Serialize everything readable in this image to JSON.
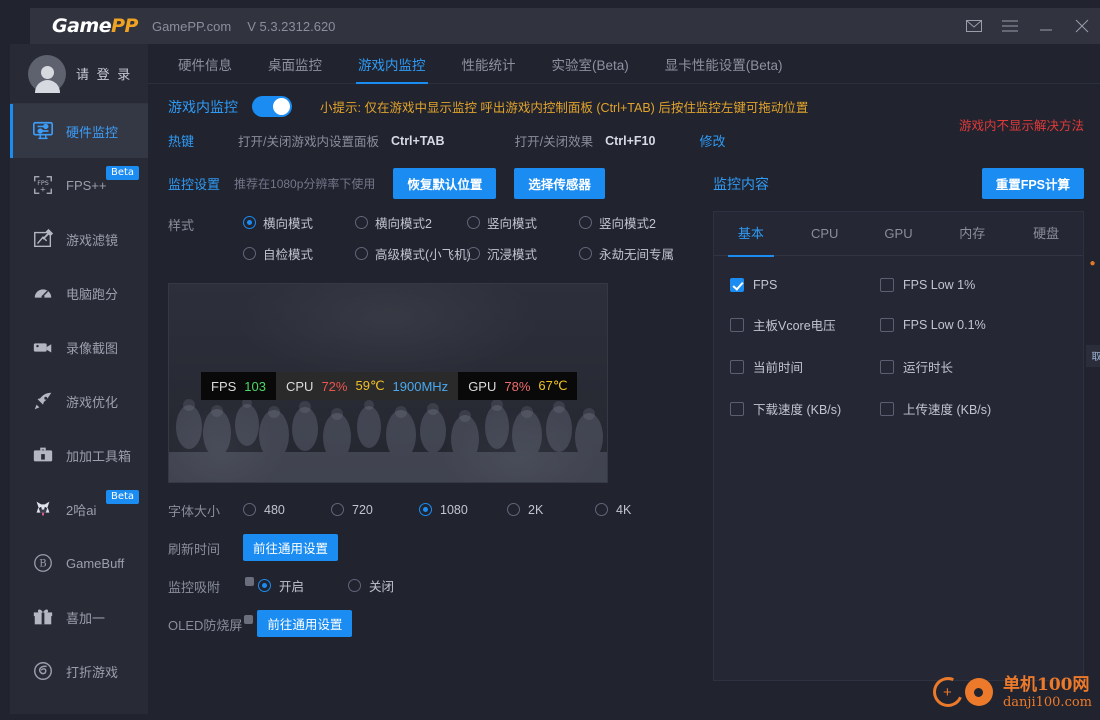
{
  "titlebar": {
    "logo_game": "Game",
    "logo_pp": "PP",
    "site": "GamePP.com",
    "version": "V 5.3.2312.620",
    "mail_icon": "mail-icon",
    "menu_icon": "menu-icon",
    "minimize_icon": "minimize-icon",
    "close_icon": "close-icon"
  },
  "sidebar": {
    "profile_label": "请 登 录",
    "items": [
      {
        "label": "硬件监控",
        "icon": "hardware-monitor-icon",
        "active": true,
        "badge": ""
      },
      {
        "label": "FPS++",
        "icon": "fps-plus-icon",
        "active": false,
        "badge": "Beta"
      },
      {
        "label": "游戏滤镜",
        "icon": "game-filter-icon",
        "active": false,
        "badge": ""
      },
      {
        "label": "电脑跑分",
        "icon": "benchmark-icon",
        "active": false,
        "badge": ""
      },
      {
        "label": "录像截图",
        "icon": "camera-icon",
        "active": false,
        "badge": ""
      },
      {
        "label": "游戏优化",
        "icon": "rocket-icon",
        "active": false,
        "badge": ""
      },
      {
        "label": "加加工具箱",
        "icon": "toolbox-icon",
        "active": false,
        "badge": ""
      },
      {
        "label": "2哈ai",
        "icon": "husky-icon",
        "active": false,
        "badge": "Beta"
      },
      {
        "label": "GameBuff",
        "icon": "gamebuff-icon",
        "active": false,
        "badge": ""
      },
      {
        "label": "喜加一",
        "icon": "gift-icon",
        "active": false,
        "badge": ""
      },
      {
        "label": "打折游戏",
        "icon": "discount-icon",
        "active": false,
        "badge": ""
      }
    ]
  },
  "tabs": [
    {
      "label": "硬件信息",
      "active": false
    },
    {
      "label": "桌面监控",
      "active": false
    },
    {
      "label": "游戏内监控",
      "active": true
    },
    {
      "label": "性能统计",
      "active": false
    },
    {
      "label": "实验室(Beta)",
      "active": false
    },
    {
      "label": "显卡性能设置(Beta)",
      "active": false
    }
  ],
  "toggle_row": {
    "label": "游戏内监控",
    "enabled": true,
    "tip": "小提示: 仅在游戏中显示监控 呼出游戏内控制面板 (Ctrl+TAB) 后按住监控左键可拖动位置"
  },
  "hotkey_row": {
    "title": "热键",
    "item1_label": "打开/关闭游戏内设置面板",
    "item1_key": "Ctrl+TAB",
    "item2_label": "打开/关闭效果",
    "item2_key": "Ctrl+F10",
    "modify_link": "修改",
    "red_link": "游戏内不显示解决方法"
  },
  "settings_header": {
    "title": "监控设置",
    "hint": "推荐在1080p分辨率下使用",
    "restore_btn": "恢复默认位置",
    "sensor_btn": "选择传感器"
  },
  "style_row": {
    "label": "样式",
    "options": [
      {
        "label": "横向模式",
        "selected": true
      },
      {
        "label": "横向模式2",
        "selected": false
      },
      {
        "label": "竖向模式",
        "selected": false
      },
      {
        "label": "竖向模式2",
        "selected": false
      },
      {
        "label": "自检模式",
        "selected": false
      },
      {
        "label": "高级模式(小飞机)",
        "selected": false
      },
      {
        "label": "沉浸模式",
        "selected": false
      },
      {
        "label": "永劫无间专属",
        "selected": false
      }
    ]
  },
  "preview_overlay": {
    "fps_label": "FPS",
    "fps_value": "103",
    "cpu_label": "CPU",
    "cpu_usage": "72%",
    "cpu_temp": "59℃",
    "cpu_clock": "1900MHz",
    "gpu_label": "GPU",
    "gpu_usage": "78%",
    "gpu_temp": "67℃"
  },
  "font_size_row": {
    "label": "字体大小",
    "options": [
      {
        "label": "480",
        "selected": false
      },
      {
        "label": "720",
        "selected": false
      },
      {
        "label": "1080",
        "selected": true
      },
      {
        "label": "2K",
        "selected": false
      },
      {
        "label": "4K",
        "selected": false
      }
    ]
  },
  "refresh_row": {
    "label": "刷新时间",
    "button": "前往通用设置"
  },
  "snap_row": {
    "label": "监控吸附",
    "options": [
      {
        "label": "开启",
        "selected": true
      },
      {
        "label": "关闭",
        "selected": false
      }
    ]
  },
  "oled_row": {
    "label": "OLED防烧屏",
    "button": "前往通用设置"
  },
  "right_panel": {
    "title": "监控内容",
    "reset_button": "重置FPS计算",
    "tabs": [
      {
        "label": "基本",
        "active": true
      },
      {
        "label": "CPU",
        "active": false
      },
      {
        "label": "GPU",
        "active": false
      },
      {
        "label": "内存",
        "active": false
      },
      {
        "label": "硬盘",
        "active": false
      }
    ],
    "checkboxes": [
      {
        "label": "FPS",
        "checked": true
      },
      {
        "label": "FPS Low 1%",
        "checked": false
      },
      {
        "label": "主板Vcore电压",
        "checked": false
      },
      {
        "label": "FPS Low 0.1%",
        "checked": false
      },
      {
        "label": "当前时间",
        "checked": false
      },
      {
        "label": "运行时长",
        "checked": false
      },
      {
        "label": "下载速度 (KB/s)",
        "checked": false
      },
      {
        "label": "上传速度 (KB/s)",
        "checked": false
      }
    ]
  },
  "edge_tab": {
    "label": "取"
  },
  "watermark": {
    "line1": "单机100网",
    "line2": "danji100.com"
  },
  "colors": {
    "accent": "#1b8cf2",
    "accent_text": "#2f9bf5",
    "warning": "#e2a42c",
    "danger": "#e03a3a",
    "bg": "#21232e",
    "panel": "#282a36"
  }
}
